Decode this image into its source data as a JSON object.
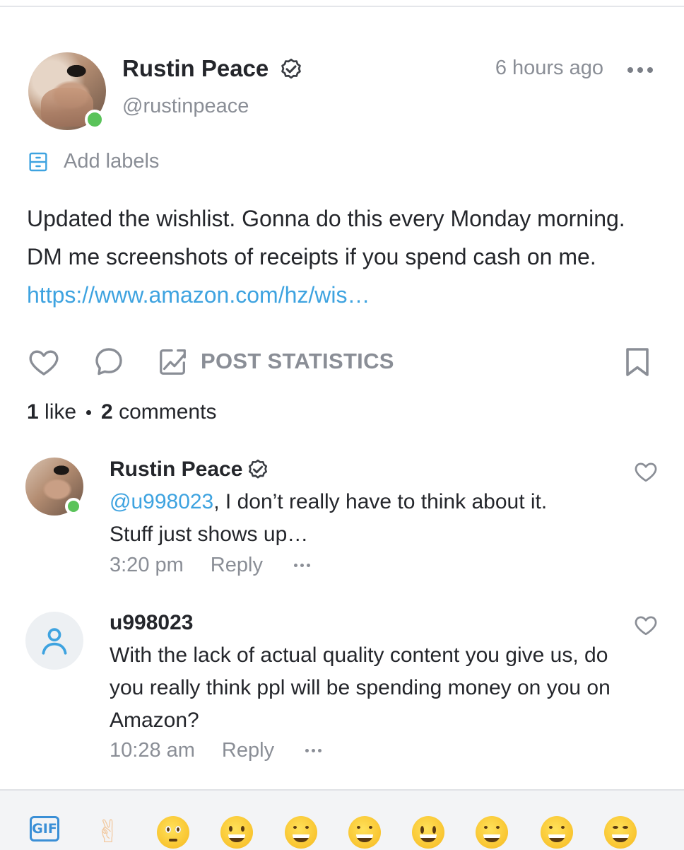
{
  "post": {
    "author": {
      "name": "Rustin Peace",
      "handle": "@rustinpeace",
      "verified": true,
      "online": true
    },
    "time_ago": "6 hours ago",
    "labels_action": "Add labels",
    "text": "Updated the wishlist. Gonna do this every Monday morning. DM me screenshots of receipts if you spend cash on me.",
    "link": "https://www.amazon.com/hz/wis…",
    "actions": {
      "stats_label": "POST STATISTICS"
    },
    "counts": {
      "likes_number": "1",
      "likes_word": "like",
      "comments_number": "2",
      "comments_word": "comments"
    }
  },
  "comments": [
    {
      "author": "Rustin Peace",
      "verified": true,
      "mention": "@u998023",
      "text_line1": ", I don’t really have to think about it.",
      "text_line2": "Stuff just shows up…",
      "time": "3:20 pm",
      "reply_label": "Reply"
    },
    {
      "author": "u998023",
      "verified": false,
      "text": "With the lack of actual quality content you give us, do you really think ppl will be spending money on you on Amazon?",
      "time": "10:28 am",
      "reply_label": "Reply"
    }
  ],
  "emoji_bar": {
    "gif_label": "GIF",
    "items": [
      "victory-hand",
      "pleading-face",
      "grinning-face",
      "beaming-face",
      "tears-of-joy-face",
      "grinning-big-eyes-face",
      "grinning-smiling-eyes-face",
      "sweat-smile-face",
      "squinting-face"
    ]
  },
  "colors": {
    "link": "#3ea3e0",
    "muted": "#8a8e96",
    "online": "#5ac35a",
    "gif": "#3a8fd6"
  }
}
